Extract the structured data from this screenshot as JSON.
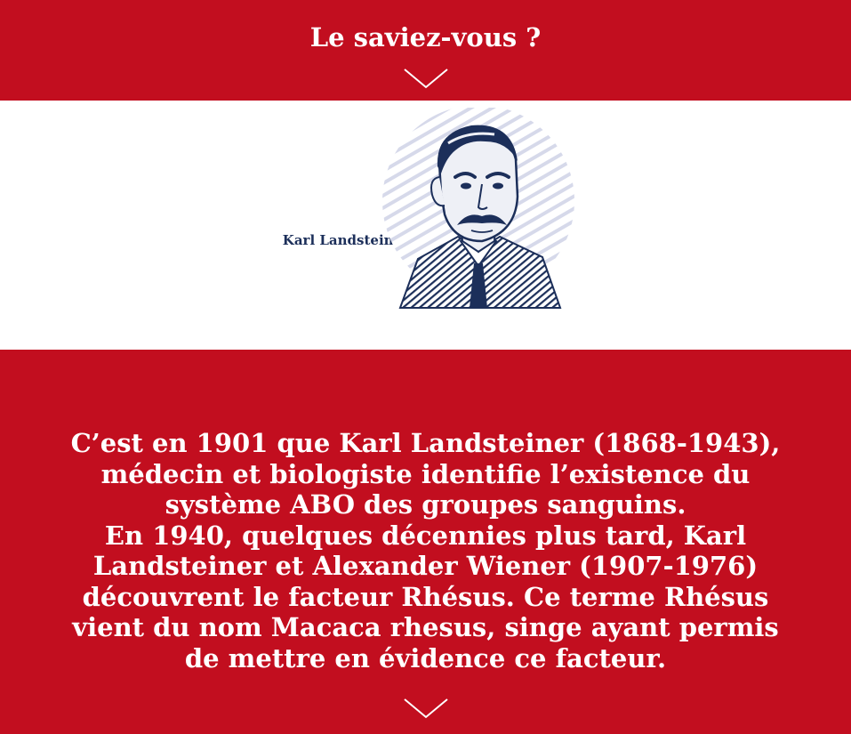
{
  "header": {
    "title": "Le saviez-vous ?",
    "chevron_icon": "chevron-down-icon"
  },
  "portrait": {
    "name": "Karl Landsteiner",
    "icon": "portrait-illustration"
  },
  "fact": {
    "paragraph_1": "C’est en 1901 que Karl Landsteiner (1868-1943), médecin et biologiste identifie l’existence du système ABO des groupes sanguins.",
    "paragraph_2": "En 1940, quelques décennies plus tard, Karl Landsteiner et Alexander Wiener (1907-1976) découvrent le facteur Rhésus. Ce terme Rhésus vient du nom Macaca rhesus, singe ayant permis de mettre en évidence ce facteur."
  },
  "colors": {
    "brand_red": "#c20e1f",
    "navy": "#1c2f5a",
    "stripe_lavender": "#d6d9ea",
    "white": "#ffffff"
  }
}
